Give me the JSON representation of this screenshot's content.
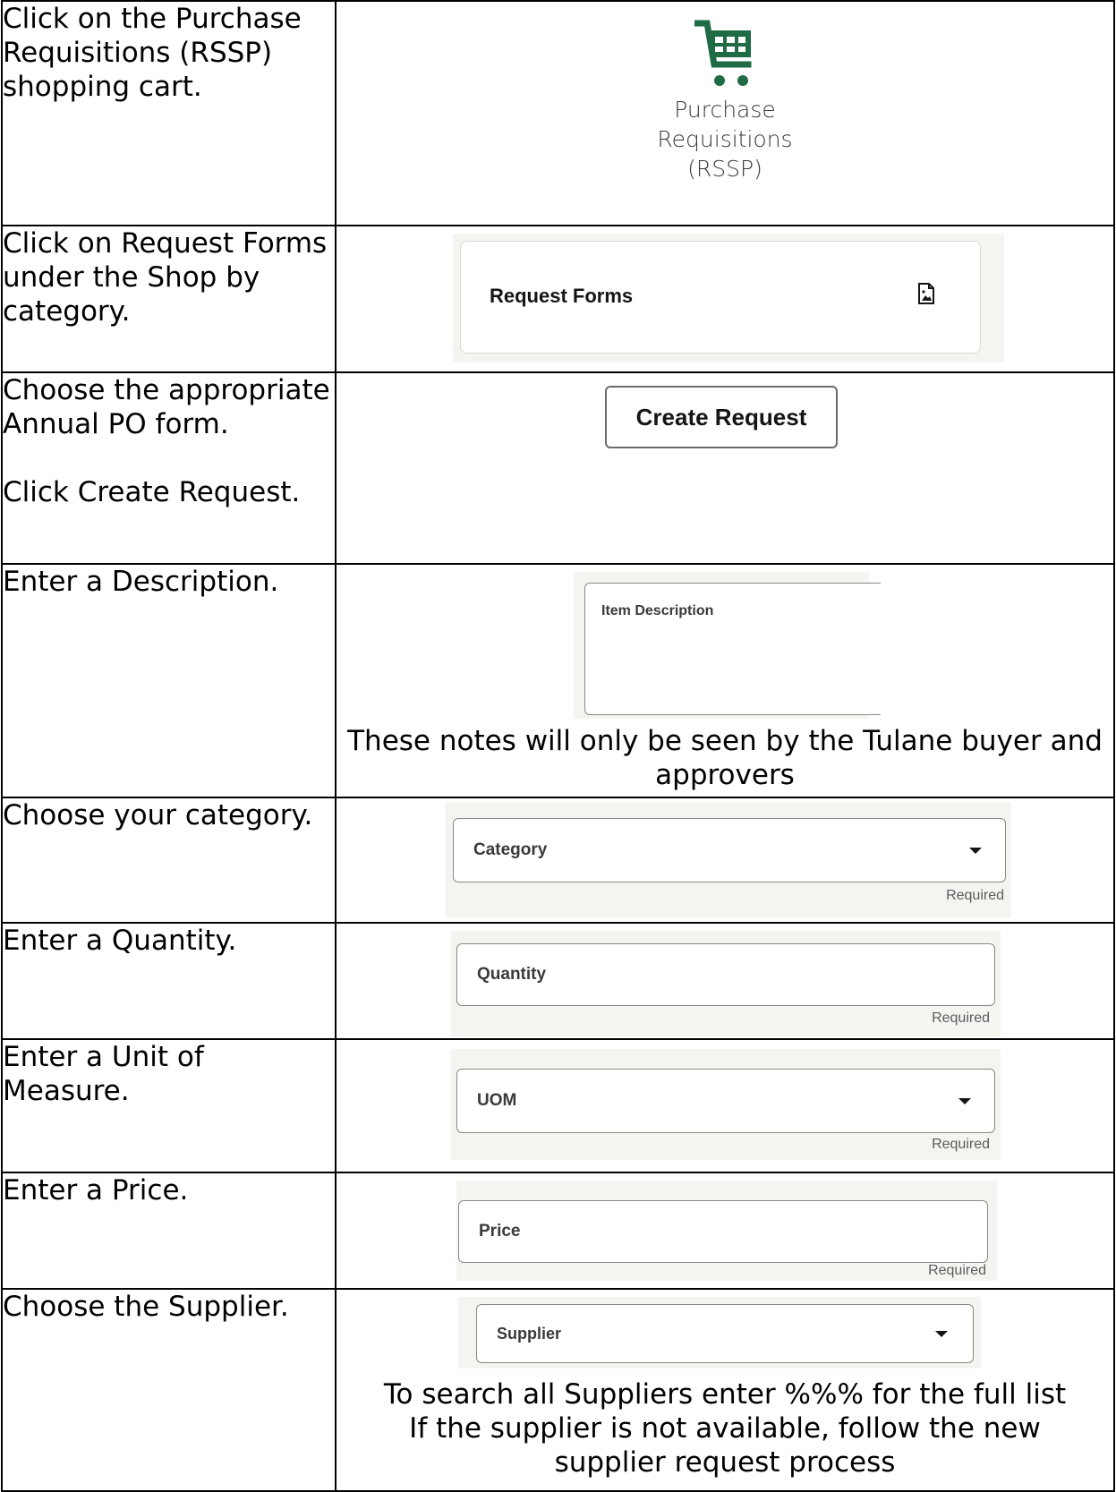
{
  "steps": [
    {
      "instruction": "Click on the Purchase Requisitions (RSSP) shopping cart.",
      "widget": {
        "type": "cart-icon",
        "icon": "shopping-cart-icon",
        "color": "#1f6b45",
        "label_lines": [
          "Purchase",
          "Requisitions",
          "(RSSP)"
        ]
      }
    },
    {
      "instruction": "Click on Request Forms under the Shop by category.",
      "widget": {
        "type": "card",
        "label": "Request Forms",
        "icon": "document-image-icon"
      }
    },
    {
      "instruction": "Choose the appropriate Annual PO form.",
      "instruction_2": "Click Create Request.",
      "widget": {
        "type": "button",
        "label": "Create Request"
      }
    },
    {
      "instruction": "Enter a Description.",
      "widget": {
        "type": "textarea",
        "label": "Item Description"
      },
      "note": "These notes will only be seen by the Tulane buyer and approvers"
    },
    {
      "instruction": "Choose your category.",
      "widget": {
        "type": "select",
        "label": "Category",
        "helper": "Required"
      }
    },
    {
      "instruction": "Enter a Quantity.",
      "widget": {
        "type": "input",
        "label": "Quantity",
        "helper": "Required"
      }
    },
    {
      "instruction": "Enter a Unit of Measure.",
      "widget": {
        "type": "select",
        "label": "UOM",
        "helper": "Required"
      }
    },
    {
      "instruction": "Enter a Price.",
      "widget": {
        "type": "input",
        "label": "Price",
        "helper": "Required"
      }
    },
    {
      "instruction": "Choose the Supplier.",
      "widget": {
        "type": "select",
        "label": "Supplier"
      },
      "note_lines": [
        "To search all Suppliers enter %%% for the full list",
        "If the supplier is not available, follow the new",
        "supplier request process"
      ]
    }
  ],
  "colors": {
    "panel_background": "#f6f4f1",
    "field_border": "#8a8883",
    "cart_green": "#1f6b45"
  }
}
